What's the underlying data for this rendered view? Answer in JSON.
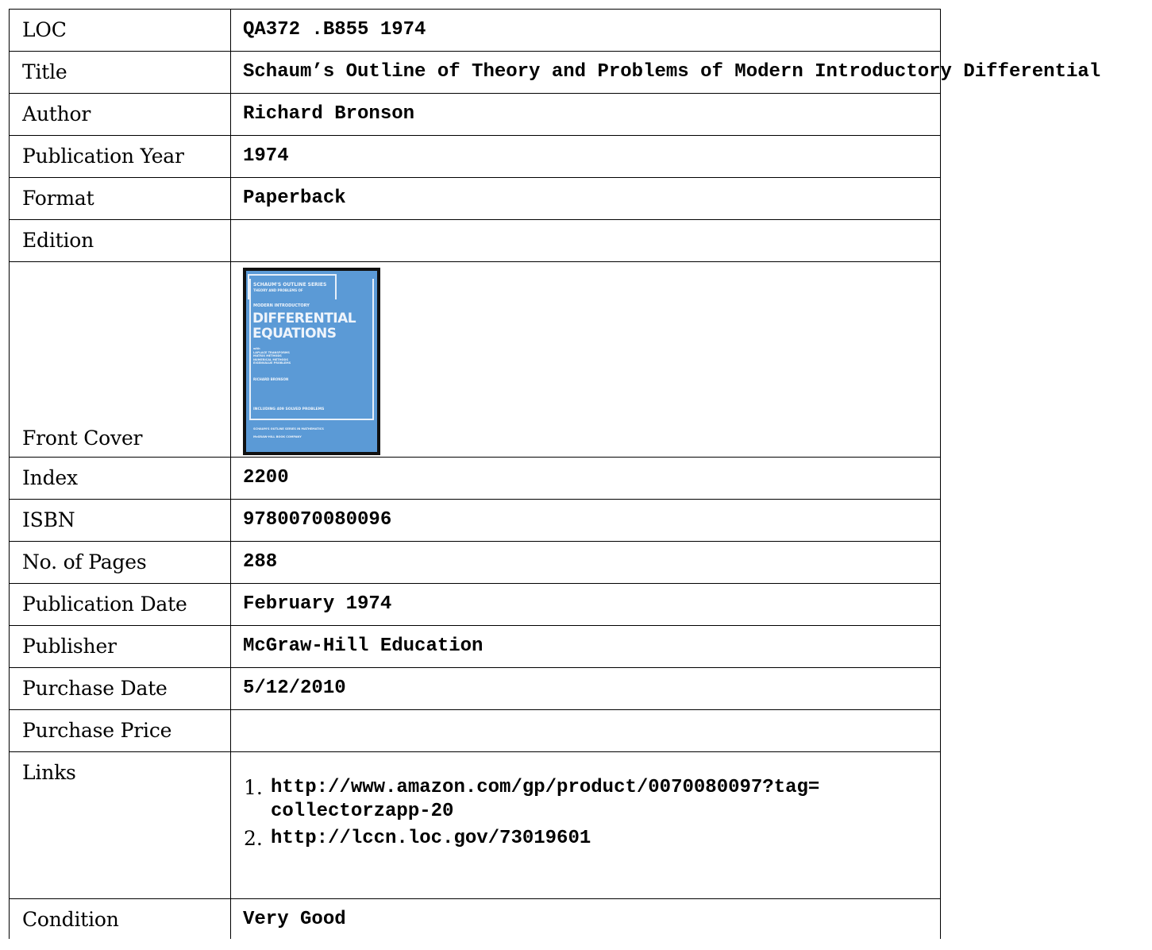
{
  "record": {
    "loc": {
      "label": "LOC",
      "value": "QA372 .B855 1974"
    },
    "title": {
      "label": "Title",
      "value": "Schaum’s Outline of Theory and Problems of Modern Introductory Differential"
    },
    "author": {
      "label": "Author",
      "value": "Richard Bronson"
    },
    "publication_year": {
      "label": "Publication Year",
      "value": "1974"
    },
    "format": {
      "label": "Format",
      "value": "Paperback"
    },
    "edition": {
      "label": "Edition",
      "value": ""
    },
    "front_cover": {
      "label": "Front Cover",
      "cover_text": {
        "series": "SCHAUM'S OUTLINE SERIES",
        "theory": "THEORY AND PROBLEMS OF",
        "modern": "MODERN INTRODUCTORY",
        "title_line1": "DIFFERENTIAL",
        "title_line2": "EQUATIONS",
        "subtitle": "with\nLAPLACE TRANSFORMS\nMATRIX METHODS\nNUMERICAL METHODS\nEIGENVALUE PROBLEMS",
        "author": "RICHARD BRONSON",
        "solved": "INCLUDING 409 SOLVED PROBLEMS",
        "series_math": "SCHAUM'S OUTLINE SERIES IN MATHEMATICS",
        "publisher": "McGRAW-HILL BOOK COMPANY"
      },
      "cover_color": "#5b9ad6"
    },
    "index": {
      "label": "Index",
      "value": "2200"
    },
    "isbn": {
      "label": "ISBN",
      "value": "9780070080096"
    },
    "pages": {
      "label": "No. of Pages",
      "value": "288"
    },
    "publication_date": {
      "label": "Publication Date",
      "value": "February 1974"
    },
    "publisher": {
      "label": "Publisher",
      "value": "McGraw-Hill Education"
    },
    "purchase_date": {
      "label": "Purchase Date",
      "value": "5/12/2010"
    },
    "purchase_price": {
      "label": "Purchase Price",
      "value": ""
    },
    "links": {
      "label": "Links",
      "items": [
        {
          "num": "1.",
          "text": "http://www.amazon.com/gp/product/0070080097?tag=\ncollectorzapp-20"
        },
        {
          "num": "2.",
          "text": "http://lccn.loc.gov/73019601"
        }
      ]
    },
    "condition": {
      "label": "Condition",
      "value": "Very Good"
    }
  }
}
